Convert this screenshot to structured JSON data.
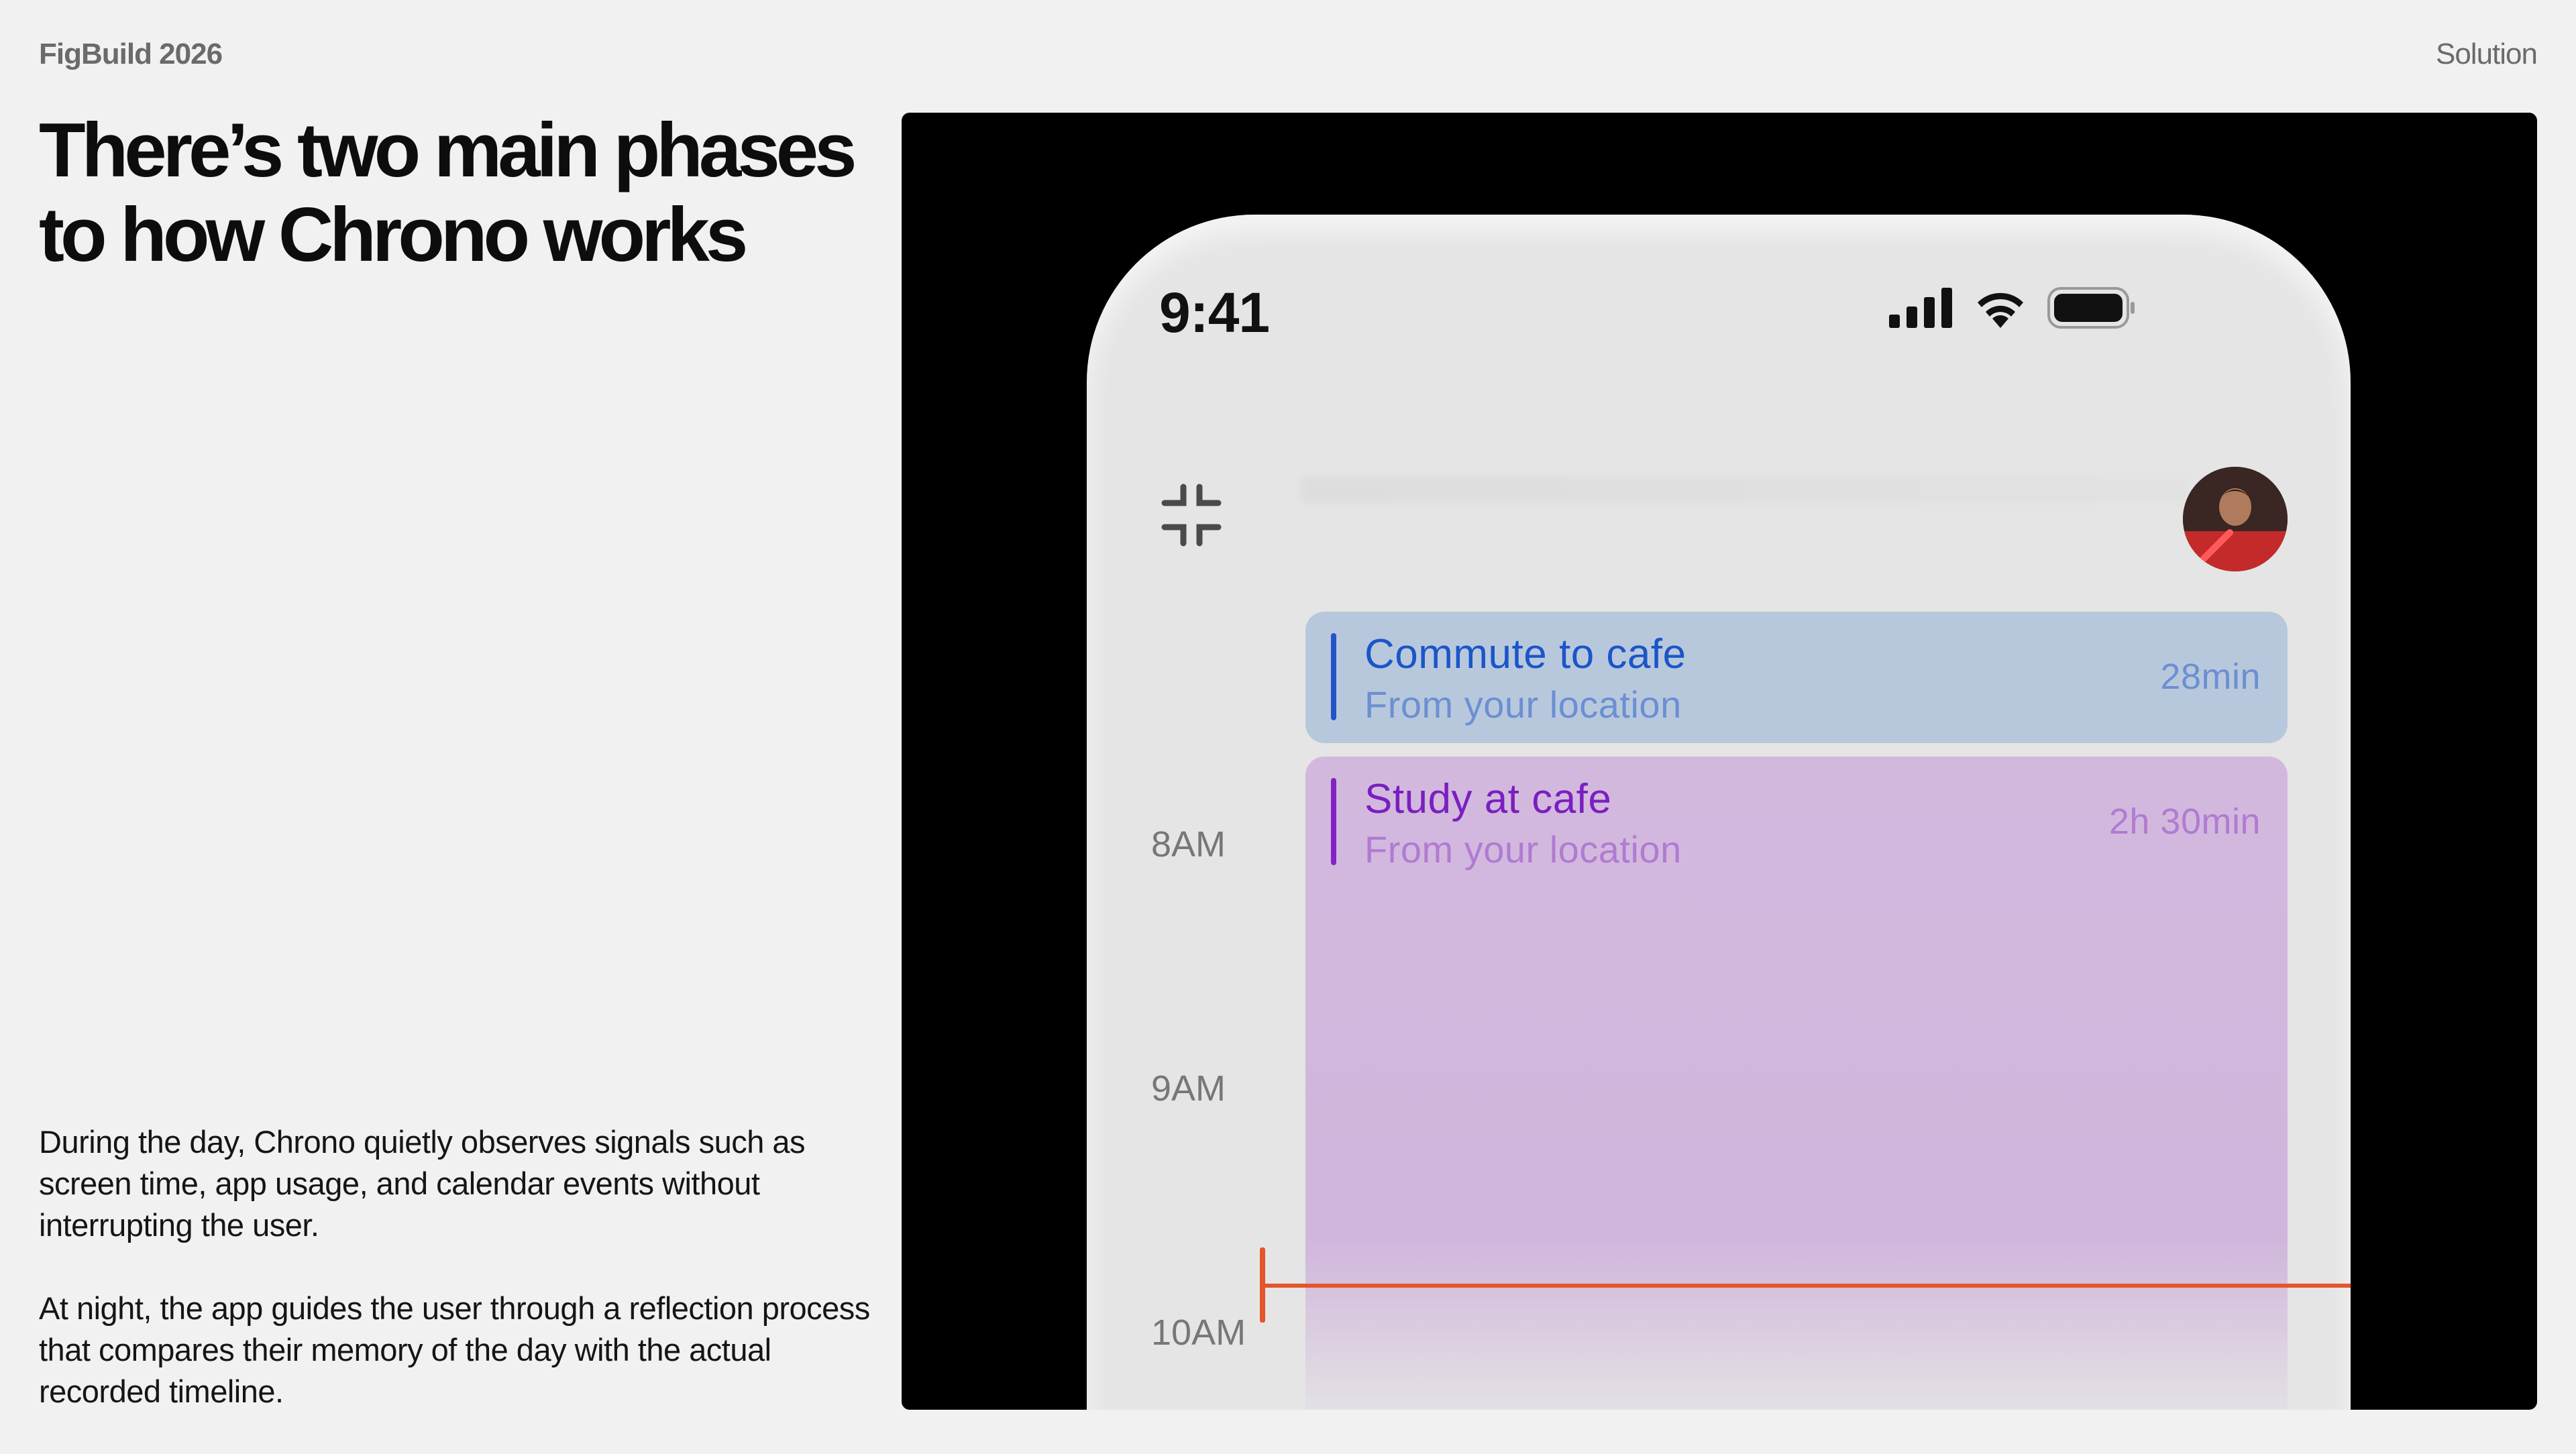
{
  "header": {
    "brand": "FigBuild 2026",
    "section": "Solution"
  },
  "headline": {
    "line1": "There’s two main phases",
    "line2": "to how Chrono works"
  },
  "body": {
    "paragraph1": "During the day, Chrono quietly observes signals such as screen time, app usage, and calendar events without interrupting the user.",
    "paragraph2": "At night, the app guides the user through a reflection process that compares their memory of the day with the actual recorded timeline."
  },
  "phone": {
    "status": {
      "time": "9:41",
      "icons": [
        "cellular-signal-icon",
        "wifi-icon",
        "battery-icon"
      ]
    },
    "toolbar": {
      "left_icon": "collapse-icon",
      "avatar": "user-avatar"
    },
    "timeline": {
      "hours": [
        "8AM",
        "9AM",
        "10AM"
      ],
      "events": [
        {
          "title": "Commute to cafe",
          "subtitle": "From your location",
          "duration": "28min",
          "color": "#b8c8dc",
          "accent": "#2453c9"
        },
        {
          "title": "Study at cafe",
          "subtitle": "From your location",
          "duration": "2h 30min",
          "color": "#d3b8de",
          "accent": "#8423c4"
        }
      ],
      "now_indicator_color": "#e5552b"
    }
  }
}
